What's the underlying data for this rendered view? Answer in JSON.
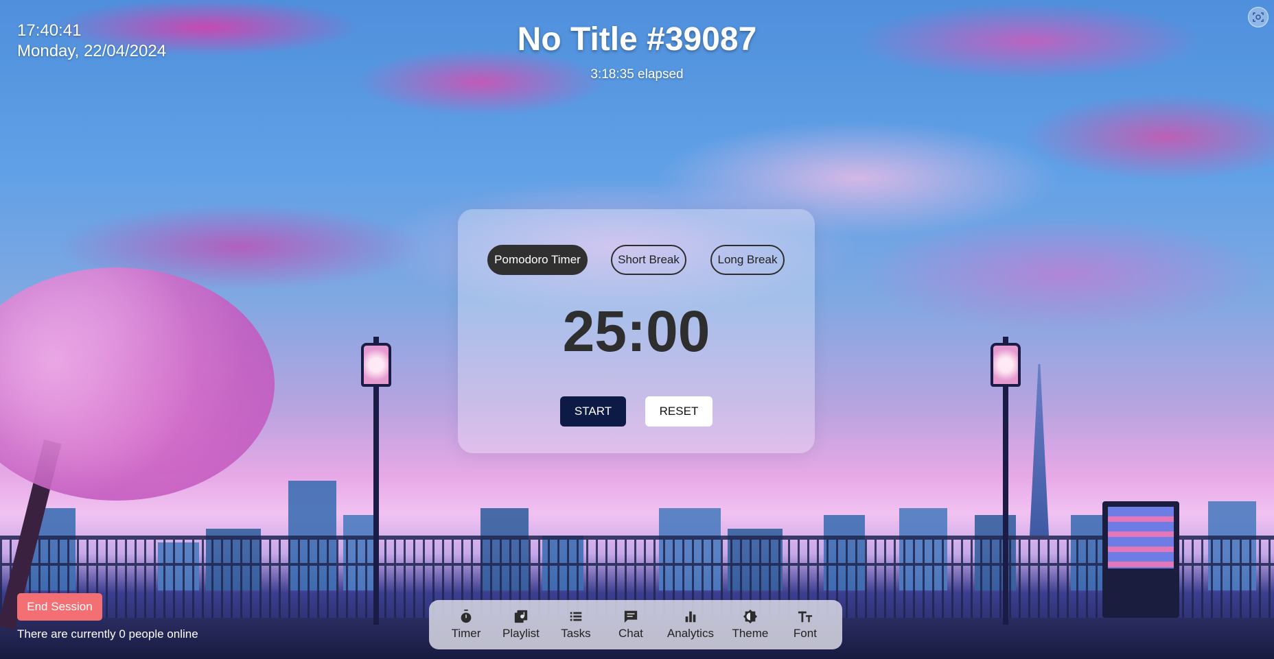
{
  "clock": {
    "time": "17:40:41",
    "date": "Monday, 22/04/2024"
  },
  "header": {
    "title": "No Title #39087",
    "elapsed": "3:18:35 elapsed"
  },
  "corner_button": {
    "icon": "camera-scan-icon"
  },
  "timer": {
    "modes": [
      {
        "label": "Pomodoro Timer",
        "active": true
      },
      {
        "label": "Short Break",
        "active": false
      },
      {
        "label": "Long Break",
        "active": false
      }
    ],
    "display": "25:00",
    "start_label": "START",
    "reset_label": "RESET"
  },
  "session": {
    "end_label": "End Session",
    "online_text": "There are currently 0 people online"
  },
  "dock": {
    "items": [
      {
        "label": "Timer",
        "icon": "stopwatch-icon"
      },
      {
        "label": "Playlist",
        "icon": "playlist-icon"
      },
      {
        "label": "Tasks",
        "icon": "list-icon"
      },
      {
        "label": "Chat",
        "icon": "chat-icon"
      },
      {
        "label": "Analytics",
        "icon": "bar-chart-icon"
      },
      {
        "label": "Theme",
        "icon": "theme-icon"
      },
      {
        "label": "Font",
        "icon": "font-size-icon"
      }
    ]
  },
  "colors": {
    "start_button": "#0c1a45",
    "end_session": "#f36f73",
    "active_mode": "#303030"
  }
}
